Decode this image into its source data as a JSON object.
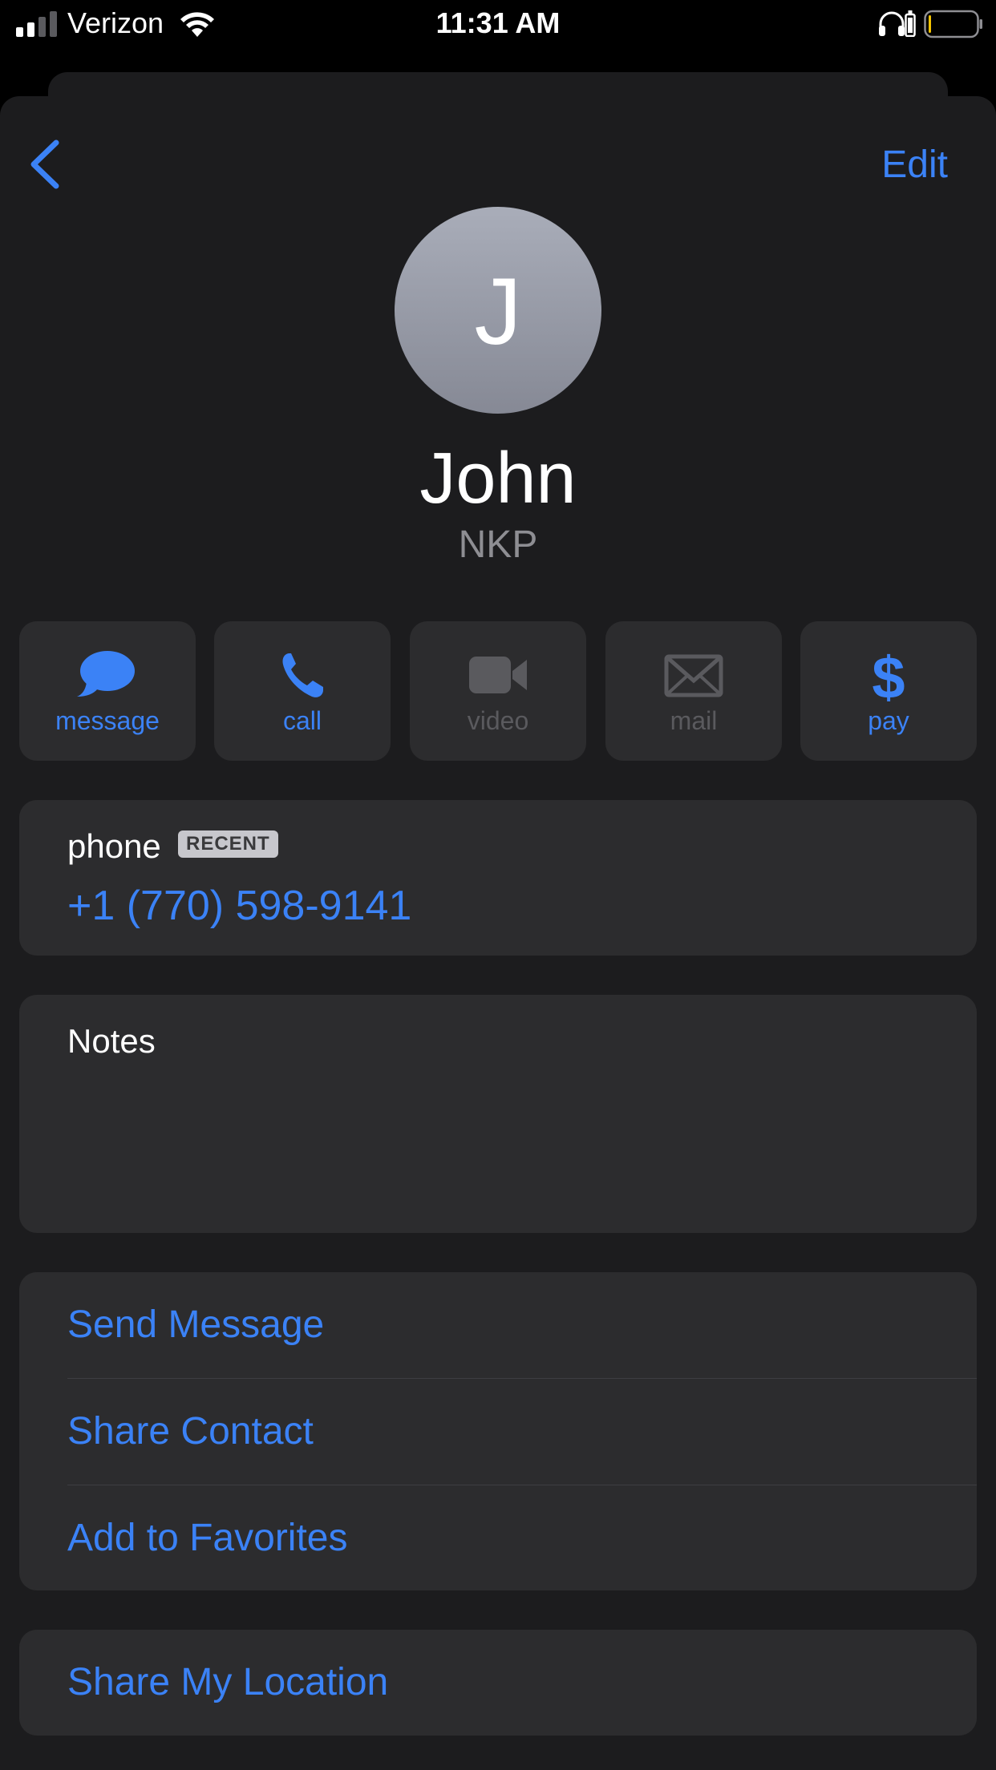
{
  "status_bar": {
    "carrier": "Verizon",
    "time": "11:31 AM",
    "signal_bars_active": 2,
    "signal_bars_total": 4,
    "battery_level_fraction": 0.04,
    "battery_color": "#f5c400",
    "icons": [
      "signal-icon",
      "wifi-icon",
      "headphones-icon",
      "charging-icon",
      "battery-icon"
    ]
  },
  "nav": {
    "back_icon": "chevron-left-icon",
    "edit_label": "Edit"
  },
  "contact": {
    "initial": "J",
    "name": "John",
    "company": "NKP"
  },
  "actions": [
    {
      "label": "message",
      "icon": "message-bubble-icon",
      "enabled": true
    },
    {
      "label": "call",
      "icon": "phone-icon",
      "enabled": true
    },
    {
      "label": "video",
      "icon": "video-camera-icon",
      "enabled": false
    },
    {
      "label": "mail",
      "icon": "envelope-icon",
      "enabled": false
    },
    {
      "label": "pay",
      "icon": "dollar-icon",
      "enabled": true
    }
  ],
  "phone": {
    "label": "phone",
    "badge": "RECENT",
    "number": "+1 (770) 598-9141"
  },
  "notes": {
    "label": "Notes"
  },
  "options": [
    {
      "label": "Send Message"
    },
    {
      "label": "Share Contact"
    },
    {
      "label": "Add to Favorites"
    }
  ],
  "location": {
    "label": "Share My Location"
  },
  "colors": {
    "accent": "#3b82f6",
    "background": "#000000",
    "sheet": "#1c1c1e",
    "card": "#2c2c2e",
    "disabled": "#5a5a5e",
    "secondary_text": "#8e8e93"
  }
}
